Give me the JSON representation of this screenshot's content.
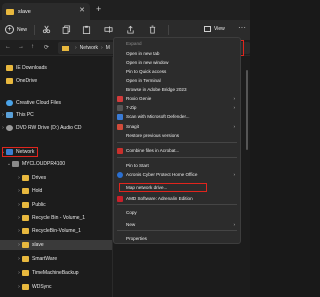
{
  "window": {
    "tab_title": "slave",
    "close_glyph": "✕",
    "newtab_glyph": "+"
  },
  "toolbar": {
    "new_label": "New",
    "view_label": "View",
    "more_glyph": "···"
  },
  "address": {
    "back": "←",
    "forward": "→",
    "up": "↑",
    "refresh": "⟳",
    "crumbs": [
      "Network",
      "M"
    ]
  },
  "sidebar": {
    "items": [
      {
        "label": "IE Downloads",
        "icon": "folder-icon"
      },
      {
        "label": "OneDrive",
        "icon": "folder-icon"
      },
      {
        "label": "Creative Cloud Files",
        "icon": "cloud-icon"
      },
      {
        "label": "This PC",
        "icon": "pc-icon"
      },
      {
        "label": "DVD RW Drive (D:) Audio CD",
        "icon": "disc-icon"
      },
      {
        "label": "Network",
        "icon": "network-icon"
      },
      {
        "label": "MYCLOUDPR4100",
        "icon": "server-icon"
      },
      {
        "label": "Drives",
        "icon": "folder-icon"
      },
      {
        "label": "Hold",
        "icon": "folder-icon"
      },
      {
        "label": "Public",
        "icon": "folder-icon"
      },
      {
        "label": "Recycle Bin - Volume_1",
        "icon": "folder-icon"
      },
      {
        "label": "RecycleBin-Volume_1",
        "icon": "folder-icon"
      },
      {
        "label": "slave",
        "icon": "folder-icon"
      },
      {
        "label": "SmartWare",
        "icon": "folder-icon"
      },
      {
        "label": "TimeMachineBackup",
        "icon": "folder-icon"
      },
      {
        "label": "WDSync",
        "icon": "folder-icon"
      }
    ]
  },
  "context_menu": {
    "items": [
      {
        "label": "Expand",
        "disabled": true
      },
      {
        "label": "Open in new tab"
      },
      {
        "label": "Open in new window"
      },
      {
        "label": "Pin to Quick access"
      },
      {
        "label": "Open in Terminal"
      },
      {
        "label": "Browse in Adobe Bridge 2023"
      },
      {
        "label": "Roxio Genie",
        "arrow": "›"
      },
      {
        "label": "7-Zip",
        "arrow": "›"
      },
      {
        "label": "Scan with Microsoft Defender..."
      },
      {
        "label": "Snagit",
        "arrow": "›"
      },
      {
        "label": "Restore previous versions"
      },
      {
        "label": "Combine files in Acrobat..."
      },
      {
        "label": "Pin to Start"
      },
      {
        "label": "Acronis Cyber Protect Home Office",
        "arrow": "›"
      },
      {
        "label": "Map network drive..."
      },
      {
        "label": "AMD Software: Adrenalin Edition"
      },
      {
        "label": "Copy"
      },
      {
        "label": "New",
        "arrow": "›"
      },
      {
        "label": "Properties"
      }
    ]
  },
  "colors": {
    "accent": "#e0251d",
    "folder": "#e8b83e",
    "background": "#1c1c1c",
    "menu": "#2c2c2c"
  }
}
